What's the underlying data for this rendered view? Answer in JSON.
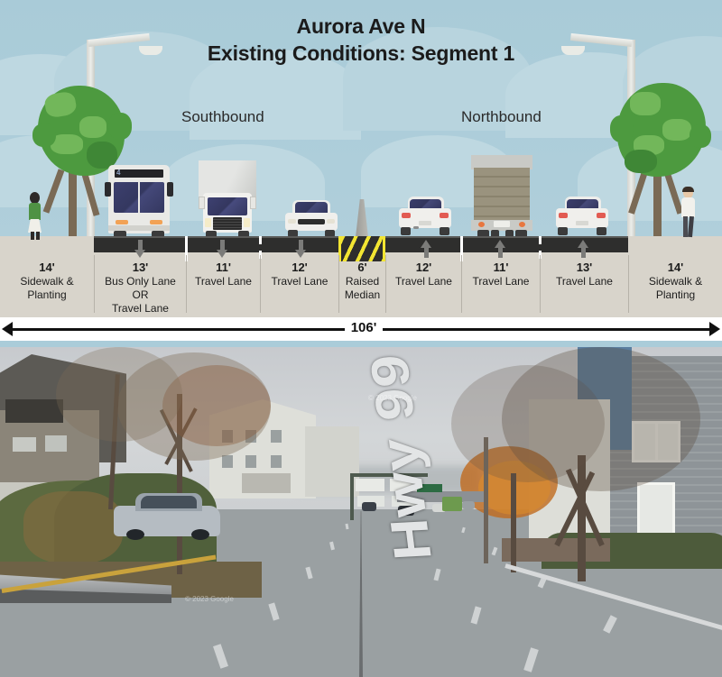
{
  "header": {
    "title_line1": "Aurora Ave N",
    "title_line2": "Existing Conditions: Segment 1"
  },
  "directions": {
    "southbound": "Southbound",
    "northbound": "Northbound"
  },
  "cross_section": {
    "total_width_label": "106'",
    "segments": [
      {
        "width": "14'",
        "name": "Sidewalk &",
        "name2": "Planting",
        "type": "sidewalk"
      },
      {
        "width": "13'",
        "name": "Bus Only Lane",
        "name2": "OR",
        "name3": "Travel Lane",
        "type": "bus-lane",
        "direction": "south"
      },
      {
        "width": "11'",
        "name": "Travel Lane",
        "type": "travel-lane",
        "direction": "south"
      },
      {
        "width": "12'",
        "name": "Travel Lane",
        "type": "travel-lane",
        "direction": "south"
      },
      {
        "width": "6'",
        "name": "Raised",
        "name2": "Median",
        "type": "median"
      },
      {
        "width": "12'",
        "name": "Travel Lane",
        "type": "travel-lane",
        "direction": "north"
      },
      {
        "width": "11'",
        "name": "Travel Lane",
        "type": "travel-lane",
        "direction": "north"
      },
      {
        "width": "13'",
        "name": "Travel Lane",
        "type": "travel-lane",
        "direction": "north"
      },
      {
        "width": "14'",
        "name": "Sidewalk &",
        "name2": "Planting",
        "type": "sidewalk"
      }
    ]
  },
  "colors": {
    "sky": "#a9cbd8",
    "cloud": "#bed8e1",
    "sidewalk": "#d8d4cb",
    "asphalt": "#2e2e2d",
    "lane_marking": "#ffffff",
    "median_hatch": "#f2e532",
    "arrow": "#7b7b79",
    "tree_canopy": "#4d9a3f",
    "text": "#1b1b1b"
  },
  "vehicles": [
    {
      "kind": "bus",
      "lane": "13' Bus Only Lane OR Travel Lane",
      "facing": "front",
      "route_sign": "4"
    },
    {
      "kind": "box-truck",
      "lane": "11' Travel Lane",
      "facing": "front"
    },
    {
      "kind": "car",
      "lane": "12' Travel Lane",
      "facing": "front"
    },
    {
      "kind": "car",
      "lane": "12' Travel Lane",
      "facing": "rear"
    },
    {
      "kind": "box-truck",
      "lane": "11' Travel Lane",
      "facing": "rear"
    },
    {
      "kind": "car",
      "lane": "13' Travel Lane",
      "facing": "rear"
    }
  ],
  "people": [
    {
      "id": "pedestrian-left",
      "side": "left"
    },
    {
      "id": "pedestrian-right",
      "side": "right"
    }
  ],
  "photo": {
    "pavement_marking": "Hwy 99",
    "attribution": "© 2023 Google"
  }
}
